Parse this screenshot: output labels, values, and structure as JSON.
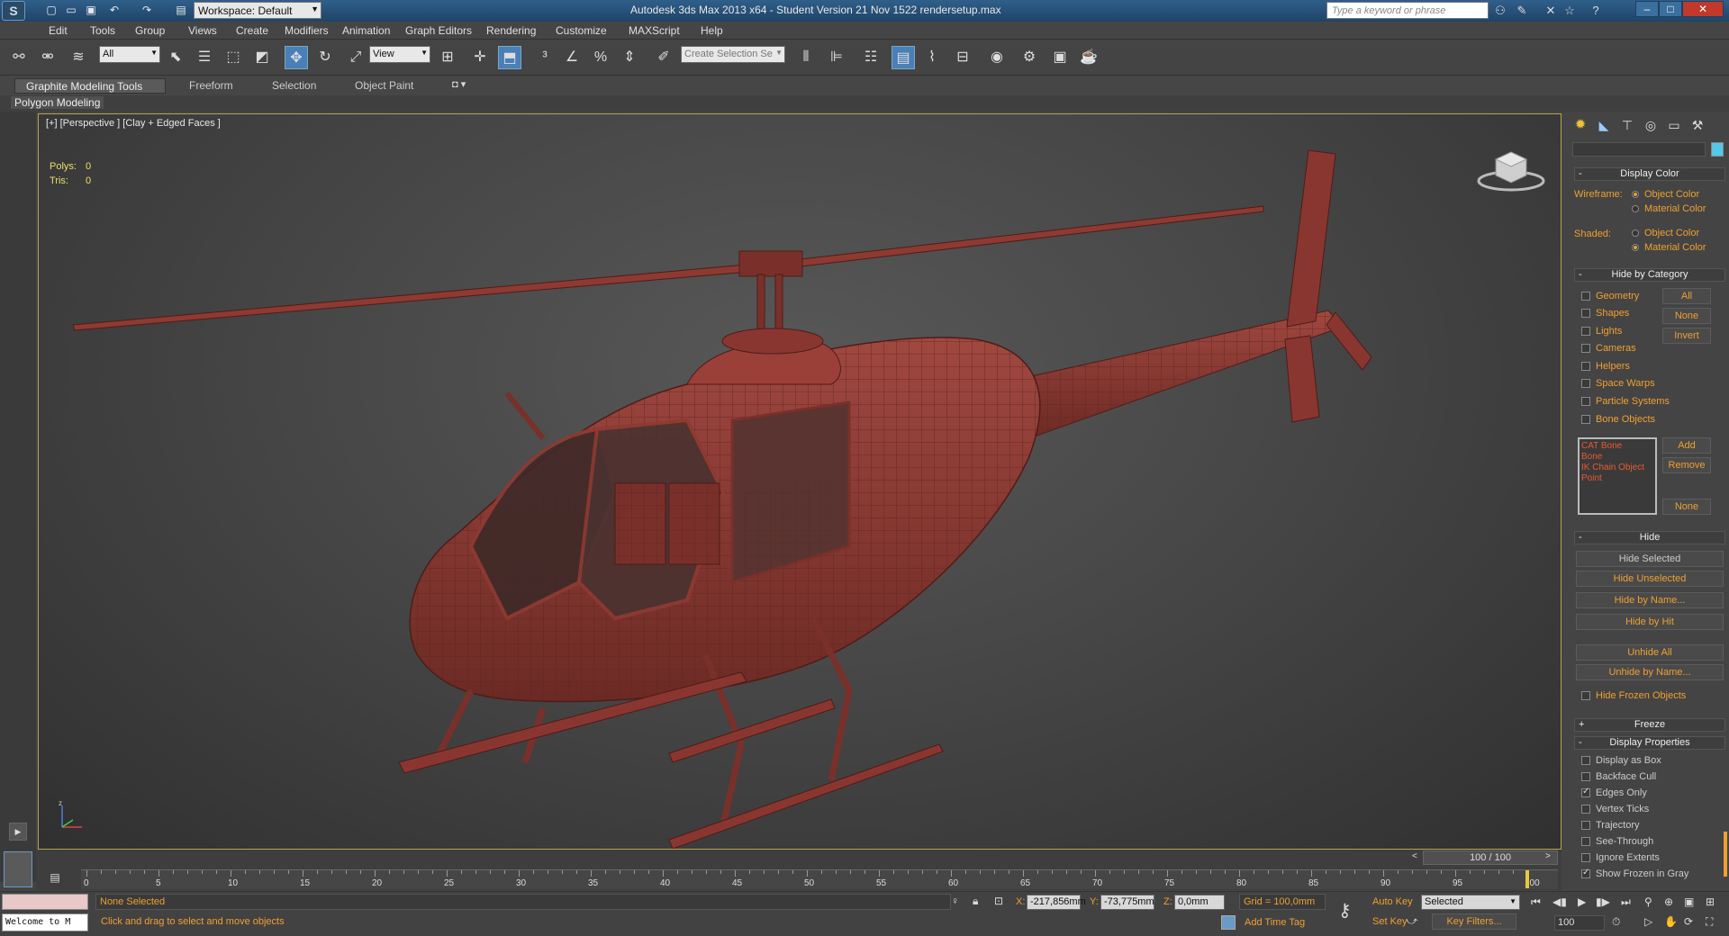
{
  "titlebar": {
    "title": "Autodesk 3ds Max  2013 x64    - Student Version    21 Nov 1522 rendersetup.max",
    "workspace": "Workspace: Default",
    "search_placeholder": "Type a keyword or phrase"
  },
  "menu": [
    "Edit",
    "Tools",
    "Group",
    "Views",
    "Create",
    "Modifiers",
    "Animation",
    "Graph Editors",
    "Rendering",
    "Customize",
    "MAXScript",
    "Help"
  ],
  "toolbar": {
    "filter_value": "All",
    "coord_value": "View",
    "selection_set_placeholder": "Create Selection Se"
  },
  "ribbon": {
    "tabs": [
      "Graphite Modeling Tools",
      "Freeform",
      "Selection",
      "Object Paint"
    ],
    "subtab": "Polygon Modeling"
  },
  "viewport": {
    "label": "[+] [Perspective ] [Clay + Edged Faces ]",
    "polys_label": "Polys:",
    "polys_value": "0",
    "tris_label": "Tris:",
    "tris_value": "0",
    "model_color": "#8a3830"
  },
  "panel": {
    "display_color": {
      "title": "Display Color",
      "wireframe_label": "Wireframe:",
      "shaded_label": "Shaded:",
      "object_color": "Object Color",
      "material_color": "Material Color"
    },
    "hide_by_category": {
      "title": "Hide by Category",
      "items": [
        "Geometry",
        "Shapes",
        "Lights",
        "Cameras",
        "Helpers",
        "Space Warps",
        "Particle Systems",
        "Bone Objects"
      ],
      "all": "All",
      "none": "None",
      "invert": "Invert",
      "list": [
        "CAT Bone",
        "Bone",
        "IK Chain Object",
        "Point"
      ],
      "add": "Add",
      "remove": "Remove",
      "none2": "None"
    },
    "hide": {
      "title": "Hide",
      "buttons": [
        "Hide Selected",
        "Hide Unselected",
        "Hide by Name...",
        "Hide by Hit",
        "Unhide All",
        "Unhide by Name..."
      ],
      "frozen": "Hide Frozen Objects"
    },
    "freeze": "Freeze",
    "display_properties": {
      "title": "Display Properties",
      "items": [
        "Display as Box",
        "Backface Cull",
        "Edges Only",
        "Vertex Ticks",
        "Trajectory",
        "See-Through",
        "Ignore Extents",
        "Show Frozen in Gray"
      ]
    }
  },
  "timeline": {
    "slider": "100 / 100",
    "ticks": [
      "0",
      "5",
      "10",
      "15",
      "20",
      "25",
      "30",
      "35",
      "40",
      "45",
      "50",
      "55",
      "60",
      "65",
      "70",
      "75",
      "80",
      "85",
      "90",
      "95",
      "100"
    ]
  },
  "status": {
    "maxscript": "Welcome to M",
    "none_selected": "None Selected",
    "prompt": "Click and drag to select and move objects",
    "x_label": "X:",
    "x_value": "-217,856mm",
    "y_label": "Y:",
    "y_value": "-73,775mm",
    "z_label": "Z:",
    "z_value": "0,0mm",
    "grid": "Grid = 100,0mm",
    "add_time_tag": "Add Time Tag",
    "auto_key": "Auto Key",
    "set_key": "Set Key",
    "selected_value": "Selected",
    "key_filters": "Key Filters...",
    "frame_value": "100"
  }
}
